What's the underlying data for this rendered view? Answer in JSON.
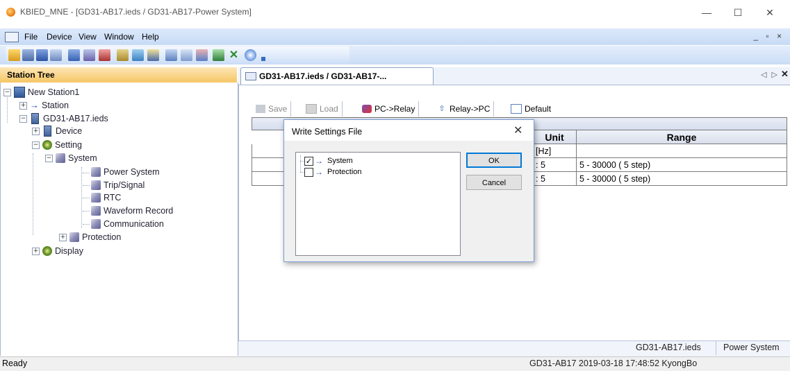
{
  "window": {
    "title": "KBIED_MNE - [GD31-AB17.ieds / GD31-AB17-Power System]",
    "minimize": "—",
    "maximize": "☐",
    "close": "✕"
  },
  "menu": {
    "items": [
      "File",
      "Device",
      "View",
      "Window",
      "Help"
    ],
    "mdi_controls": "_ ▫ ×"
  },
  "station_tree": {
    "title": "Station Tree",
    "nodes": [
      {
        "label": "New Station1",
        "expander": "−",
        "icon": "station-icon"
      },
      {
        "label": "Station",
        "expander": "+",
        "icon": "arrow-icon"
      },
      {
        "label": "GD31-AB17.ieds",
        "expander": "−",
        "icon": "device-file-icon"
      },
      {
        "label": "Device",
        "expander": "+",
        "icon": "device-icon"
      },
      {
        "label": "Setting",
        "expander": "−",
        "icon": "gear-icon"
      },
      {
        "label": "System",
        "expander": "−",
        "icon": "wrench-icon"
      },
      {
        "label": "Power System",
        "icon": "wrench-icon"
      },
      {
        "label": "Trip/Signal",
        "icon": "wrench-icon"
      },
      {
        "label": "RTC",
        "icon": "wrench-icon"
      },
      {
        "label": "Waveform Record",
        "icon": "wrench-icon"
      },
      {
        "label": "Communication",
        "icon": "wrench-icon"
      },
      {
        "label": "Protection",
        "expander": "+",
        "icon": "wrench-icon"
      },
      {
        "label": "Display",
        "expander": "+",
        "icon": "gear-icon"
      }
    ]
  },
  "document": {
    "tab_label": "GD31-AB17.ieds / GD31-AB17-...",
    "tab_nav": "◁ ▷",
    "tab_close": "✕",
    "toolbar": {
      "save": "Save",
      "load": "Load",
      "pc_to_relay": "PC->Relay",
      "relay_to_pc": "Relay->PC",
      "default": "Default"
    },
    "table": {
      "headers": {
        "unit": "Unit",
        "range": "Range"
      },
      "rows": [
        {
          "unit": "[Hz]",
          "range": ""
        },
        {
          "unit": ": 5",
          "range": "5 - 30000 ( 5 step)"
        },
        {
          "unit": ": 5",
          "range": "5 - 30000 ( 5 step)"
        }
      ]
    },
    "status_panes": [
      "GD31-AB17.ieds",
      "Power System"
    ]
  },
  "dialog": {
    "title": "Write Settings File",
    "close": "✕",
    "items": [
      {
        "label": "System",
        "checked": true,
        "check_glyph": "✓"
      },
      {
        "label": "Protection",
        "checked": false,
        "check_glyph": ""
      }
    ],
    "ok_label": "OK",
    "cancel_label": "Cancel"
  },
  "statusbar": {
    "left": "Ready",
    "right": "GD31-AB17  2019-03-18 17:48:52  KyongBo"
  }
}
